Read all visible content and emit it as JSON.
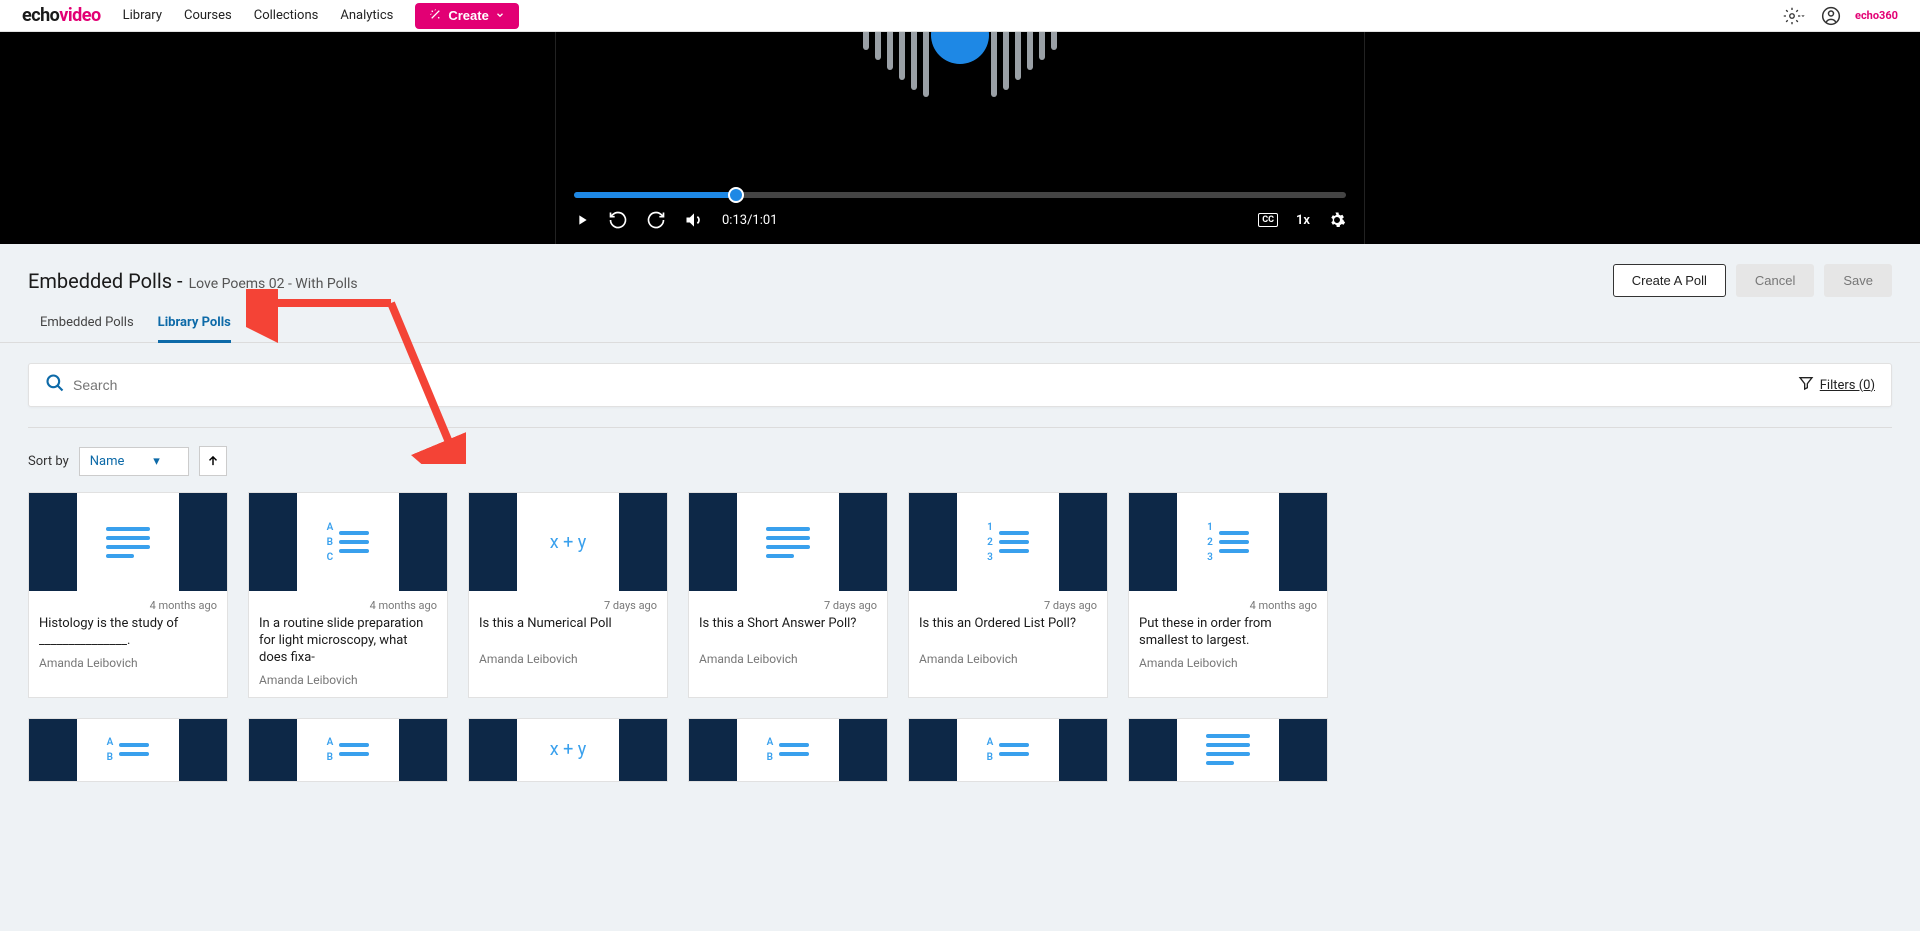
{
  "brand": {
    "part1": "echo",
    "part2": "video",
    "suffix": "echo360"
  },
  "nav": {
    "library": "Library",
    "courses": "Courses",
    "collections": "Collections",
    "analytics": "Analytics",
    "create": "Create"
  },
  "player": {
    "time": "0:13/1:01",
    "speed": "1x"
  },
  "page": {
    "title_main": "Embedded Polls - ",
    "title_sub": "Love Poems 02 - With Polls",
    "create_poll": "Create A Poll",
    "cancel": "Cancel",
    "save": "Save"
  },
  "tabs": {
    "embedded": "Embedded Polls",
    "library": "Library Polls"
  },
  "search": {
    "placeholder": "Search",
    "filters_label": "Filters (0)"
  },
  "sort": {
    "label": "Sort by",
    "value": "Name"
  },
  "polls": [
    {
      "type": "lines",
      "age": "4 months ago",
      "title": "Histology is the study of _______________.",
      "author": "Amanda Leibovich"
    },
    {
      "type": "abc",
      "age": "4 months ago",
      "title": "In a routine slide preparation for light microscopy, what does fixa-",
      "author": "Amanda Leibovich"
    },
    {
      "type": "formula",
      "age": "7 days ago",
      "title": "Is this a Numerical Poll",
      "author": "Amanda Leibovich"
    },
    {
      "type": "lines",
      "age": "7 days ago",
      "title": "Is this a Short Answer Poll?",
      "author": "Amanda Leibovich"
    },
    {
      "type": "ordered",
      "age": "7 days ago",
      "title": "Is this an Ordered List Poll?",
      "author": "Amanda Leibovich"
    },
    {
      "type": "ordered",
      "age": "4 months ago",
      "title": "Put these in order from smallest to largest.",
      "author": "Amanda Leibovich"
    },
    {
      "type": "abc-short",
      "age": "",
      "title": "",
      "author": ""
    },
    {
      "type": "abc-short",
      "age": "",
      "title": "",
      "author": ""
    },
    {
      "type": "formula",
      "age": "",
      "title": "",
      "author": ""
    },
    {
      "type": "abc-short",
      "age": "",
      "title": "",
      "author": ""
    },
    {
      "type": "abc-short",
      "age": "",
      "title": "",
      "author": ""
    },
    {
      "type": "lines",
      "age": "",
      "title": "",
      "author": ""
    }
  ]
}
